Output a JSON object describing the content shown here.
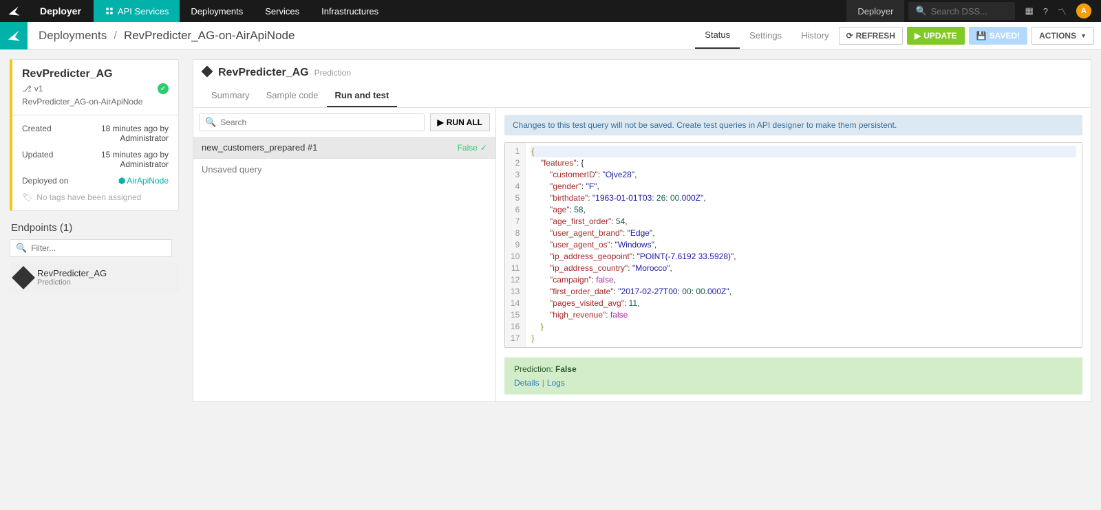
{
  "topbar": {
    "brand": "Deployer",
    "nav": [
      "API Services",
      "Deployments",
      "Services",
      "Infrastructures"
    ],
    "activeIndex": 0,
    "deployerLabel": "Deployer",
    "searchPlaceholder": "Search DSS...",
    "avatar": "A"
  },
  "breadcrumbs": {
    "items": [
      "Deployments",
      "RevPredicter_AG-on-AirApiNode"
    ]
  },
  "subheaderTabs": {
    "items": [
      "Status",
      "Settings",
      "History"
    ],
    "activeIndex": 0
  },
  "actions": {
    "refresh": "REFRESH",
    "update": "UPDATE",
    "saved": "SAVED!",
    "actions": "ACTIONS"
  },
  "serviceCard": {
    "title": "RevPredicter_AG",
    "version": "v1",
    "subtitle": "RevPredicter_AG-on-AirApiNode",
    "created_label": "Created",
    "created_value": "18 minutes ago by Administrator",
    "updated_label": "Updated",
    "updated_value": "15 minutes ago by Administrator",
    "deployed_label": "Deployed on",
    "deployed_value": "AirApiNode",
    "tags_none": "No tags have been assigned"
  },
  "endpoints": {
    "title": "Endpoints (1)",
    "filterPlaceholder": "Filter...",
    "items": [
      {
        "name": "RevPredicter_AG",
        "kind": "Prediction"
      }
    ]
  },
  "mainHeader": {
    "title": "RevPredicter_AG",
    "kind": "Prediction",
    "tabs": [
      "Summary",
      "Sample code",
      "Run and test"
    ],
    "activeIndex": 2
  },
  "leftCol": {
    "searchPlaceholder": "Search",
    "runAll": "RUN ALL",
    "query1": {
      "name": "new_customers_prepared #1",
      "result": "False"
    },
    "unsaved": "Unsaved query"
  },
  "banner": "Changes to this test query will not be saved. Create test queries in API designer to make them persistent.",
  "codeLines": [
    "{",
    "    \"features\": {",
    "        \"customerID\": \"Ojve28\",",
    "        \"gender\": \"F\",",
    "        \"birthdate\": \"1963-01-01T03:26:00.000Z\",",
    "        \"age\": 58,",
    "        \"age_first_order\": 54,",
    "        \"user_agent_brand\": \"Edge\",",
    "        \"user_agent_os\": \"Windows\",",
    "        \"ip_address_geopoint\": \"POINT(-7.6192 33.5928)\",",
    "        \"ip_address_country\": \"Morocco\",",
    "        \"campaign\": false,",
    "        \"first_order_date\": \"2017-02-27T00:00:00.000Z\",",
    "        \"pages_visited_avg\": 11,",
    "        \"high_revenue\": false",
    "    }",
    "}"
  ],
  "result": {
    "label": "Prediction:",
    "value": "False",
    "detailsLabel": "Details",
    "logsLabel": "Logs"
  }
}
